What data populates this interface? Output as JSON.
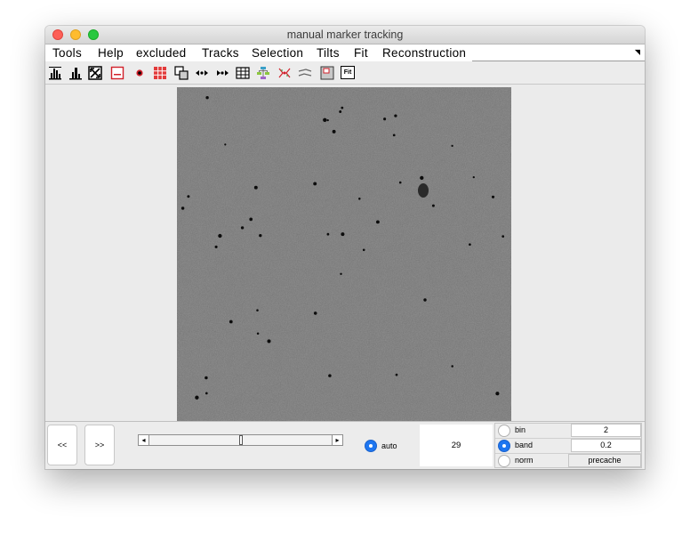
{
  "window": {
    "title": "manual marker tracking"
  },
  "menu": [
    "Tools",
    "Help",
    "excluded",
    "Tracks",
    "Selection",
    "Tilts",
    "Fit",
    "Reconstruction"
  ],
  "toolbar": {
    "icons": [
      "histogram-icon",
      "histogram-alt-icon",
      "zoom-fit-icon",
      "marker-box-icon",
      "marker-dot-icon",
      "grid-icon",
      "copy-icon",
      "move-left-right-icon",
      "move-right-icon",
      "table-icon",
      "tree-icon",
      "scatter-icon",
      "flip-icon",
      "frame-icon",
      "fit-icon"
    ],
    "fit_label": "Fit"
  },
  "navigation": {
    "prev_label": "<<",
    "next_label": ">>"
  },
  "slider": {
    "left_arrow": "◂",
    "right_arrow": "▸",
    "value_fraction": 0.5
  },
  "auto": {
    "label": "auto",
    "checked": true
  },
  "frame_number": "29",
  "params": {
    "bin": {
      "label": "bin",
      "value": "2",
      "selected": false
    },
    "band": {
      "label": "band",
      "value": "0.2",
      "selected": true
    },
    "norm": {
      "label": "norm",
      "selected": false
    },
    "precache_label": "precache"
  },
  "colors": {
    "accent": "#1e76f0",
    "micrograph_bg": "#6d6d6d",
    "marker": "#0c0c0c"
  }
}
